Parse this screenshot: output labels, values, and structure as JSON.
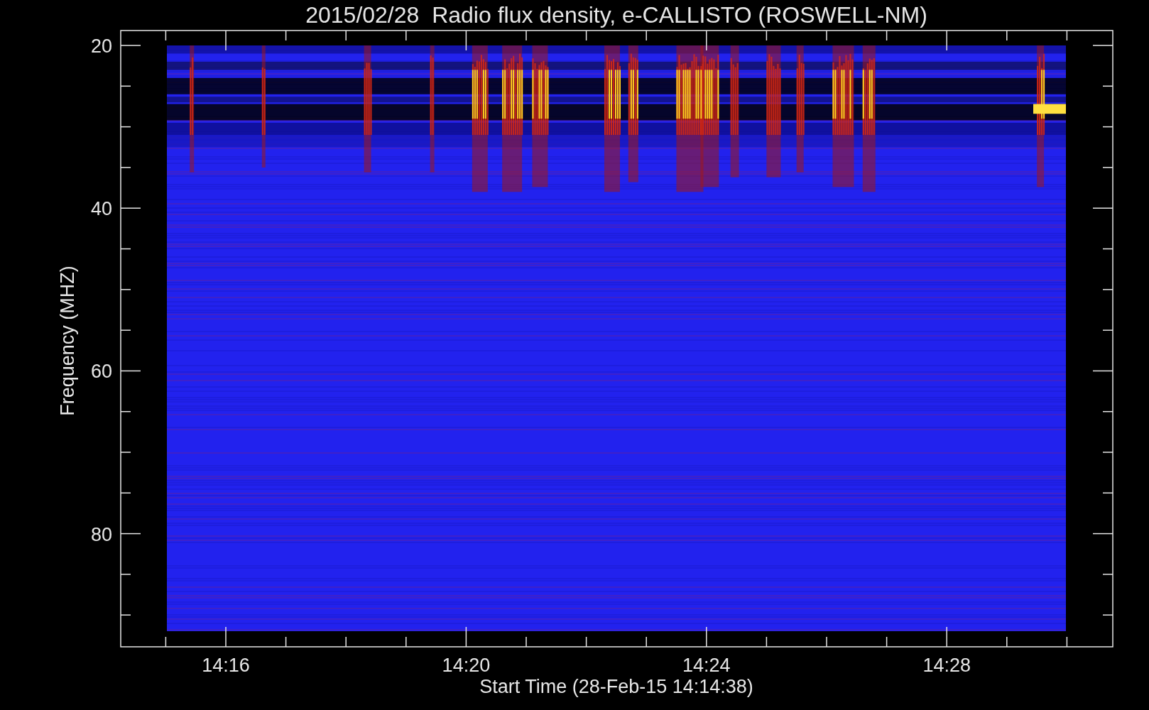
{
  "title": "2015/02/28  Radio flux density, e-CALLISTO (ROSWELL-NM)",
  "y_axis": {
    "label": "Frequency (MHZ)",
    "ticks": [
      "20",
      "40",
      "60",
      "80"
    ]
  },
  "x_axis": {
    "label": "Start Time (28-Feb-15 14:14:38)",
    "ticks": [
      "14:16",
      "14:20",
      "14:24",
      "14:28"
    ]
  }
}
